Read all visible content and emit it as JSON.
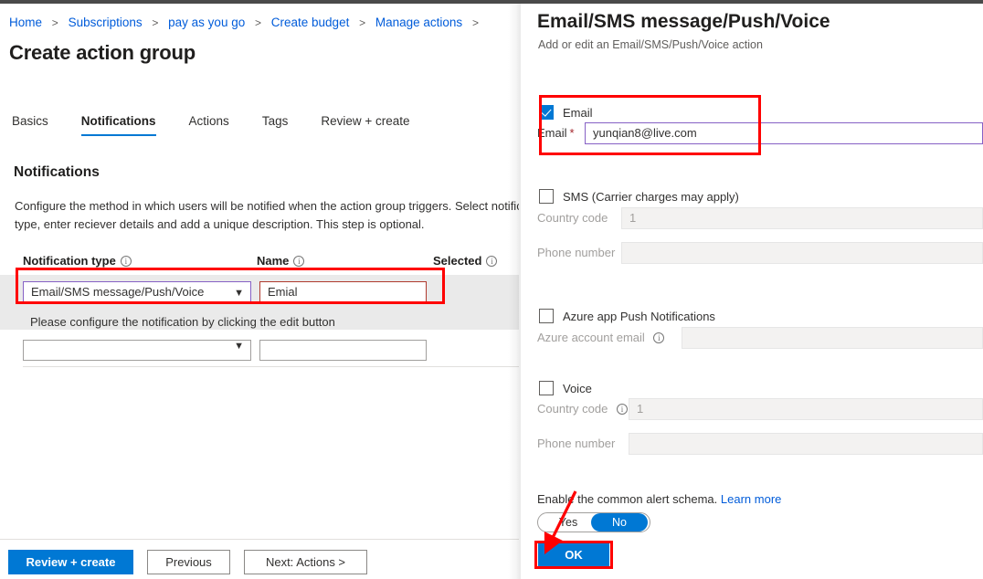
{
  "breadcrumb": {
    "items": [
      "Home",
      "Subscriptions",
      "pay as you go",
      "Create budget",
      "Manage actions"
    ],
    "separator": ">"
  },
  "page": {
    "title": "Create action group",
    "tabs": [
      {
        "label": "Basics",
        "active": false
      },
      {
        "label": "Notifications",
        "active": true
      },
      {
        "label": "Actions",
        "active": false
      },
      {
        "label": "Tags",
        "active": false
      },
      {
        "label": "Review + create",
        "active": false
      }
    ],
    "section_title": "Notifications",
    "description": "Configure the method in which users will be notified when the action group triggers. Select notification type, enter reciever details and add a unique description. This step is optional.",
    "columns": {
      "type": "Notification type",
      "name": "Name",
      "selected": "Selected",
      "info_icon": "info-icon"
    },
    "rows": [
      {
        "type_value": "Email/SMS message/Push/Voice",
        "name_value": "Emial",
        "hint": "Please configure the notification by clicking the edit button",
        "chevron": "chevron-down-icon"
      },
      {
        "type_value": "",
        "name_value": "",
        "chevron": "chevron-down-icon"
      }
    ],
    "footer_buttons": {
      "review": "Review + create",
      "previous": "Previous",
      "next": "Next: Actions >"
    }
  },
  "panel": {
    "title": "Email/SMS message/Push/Voice",
    "subtitle": "Add or edit an Email/SMS/Push/Voice action",
    "email": {
      "checkbox_label": "Email",
      "checked": true,
      "field_label": "Email",
      "required_mark": "*",
      "value": "yunqian8@live.com",
      "placeholder": ""
    },
    "sms": {
      "checkbox_label": "SMS (Carrier charges may apply)",
      "checked": false,
      "country_code_label": "Country code",
      "country_code_value": "1",
      "phone_label": "Phone number",
      "phone_value": ""
    },
    "push": {
      "checkbox_label": "Azure app Push Notifications",
      "checked": false,
      "account_label": "Azure account email",
      "account_value": "",
      "info_icon": "info-icon"
    },
    "voice": {
      "checkbox_label": "Voice",
      "checked": false,
      "country_code_label": "Country code",
      "country_code_value": "1",
      "phone_label": "Phone number",
      "phone_value": "",
      "info_icon": "info-icon"
    },
    "schema": {
      "text": "Enable the common alert schema.",
      "link": "Learn more",
      "toggle_yes": "Yes",
      "toggle_no": "No",
      "selected": "No"
    },
    "ok_button": "OK"
  },
  "colors": {
    "accent_blue": "#0078d4",
    "link_blue": "#015cda",
    "focus_purple": "#8661c5",
    "error_red": "#b03a2e",
    "annotation_red": "#ff0000",
    "row_shade": "#eaeaea",
    "disabled_field": "#f3f2f1"
  }
}
